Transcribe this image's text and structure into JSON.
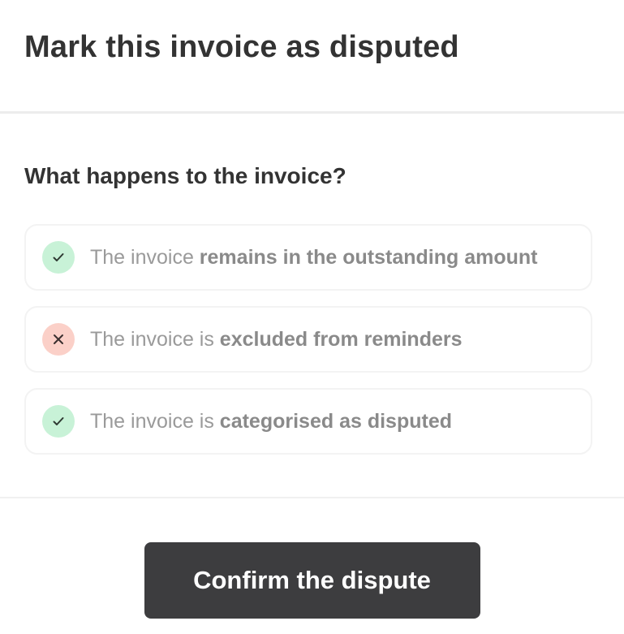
{
  "dialog": {
    "title": "Mark this invoice as disputed",
    "section_title": "What happens to the invoice?",
    "items": [
      {
        "status": "check",
        "icon": "check-icon",
        "text": "The invoice ",
        "emphasis": "remains in the outstanding amount"
      },
      {
        "status": "cross",
        "icon": "close-icon",
        "text": "The invoice is ",
        "emphasis": "excluded from reminders"
      },
      {
        "status": "check",
        "icon": "check-icon",
        "text": "The invoice is ",
        "emphasis": "categorised as disputed"
      }
    ],
    "confirm_label": "Confirm the dispute"
  },
  "colors": {
    "title": "#333333",
    "check_badge": "#c8f2d7",
    "cross_badge": "#fbd0c8",
    "item_text": "#9a9a9a",
    "button_bg": "#3d3d3f",
    "button_text": "#ffffff"
  }
}
